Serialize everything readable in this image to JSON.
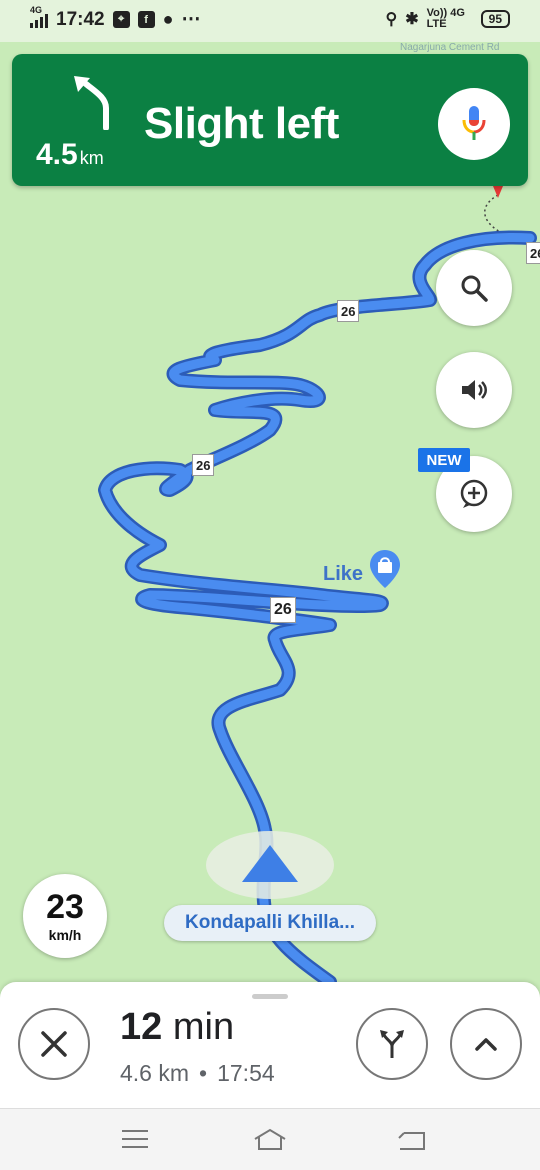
{
  "status_bar": {
    "network": "4G",
    "time": "17:42",
    "icons": [
      "signal-icon",
      "maps-icon",
      "facebook-icon",
      "chat-icon",
      "more-icon"
    ],
    "right_icons": [
      "location-icon",
      "bluetooth-icon",
      "volte-icon"
    ],
    "volte_text": "Vo)) 4G LTE",
    "battery": "95"
  },
  "map_faint_text": "Nagarjuna Cement Rd",
  "navigation": {
    "distance_value": "4.5",
    "distance_unit": "km",
    "instruction": "Slight left",
    "turn_icon": "slight-left-arrow-icon",
    "colors": {
      "banner": "#0b8043",
      "route": "#4a8cf0"
    }
  },
  "map": {
    "road_shields": [
      "26",
      "26",
      "26",
      "26"
    ],
    "poi_label": "Like",
    "new_badge": "NEW",
    "destination_label": "Kondapalli Khilla..."
  },
  "speed": {
    "value": "23",
    "unit": "km/h"
  },
  "trip": {
    "duration_value": "12",
    "duration_unit": "min",
    "distance": "4.6 km",
    "separator": "•",
    "arrival_time": "17:54"
  }
}
